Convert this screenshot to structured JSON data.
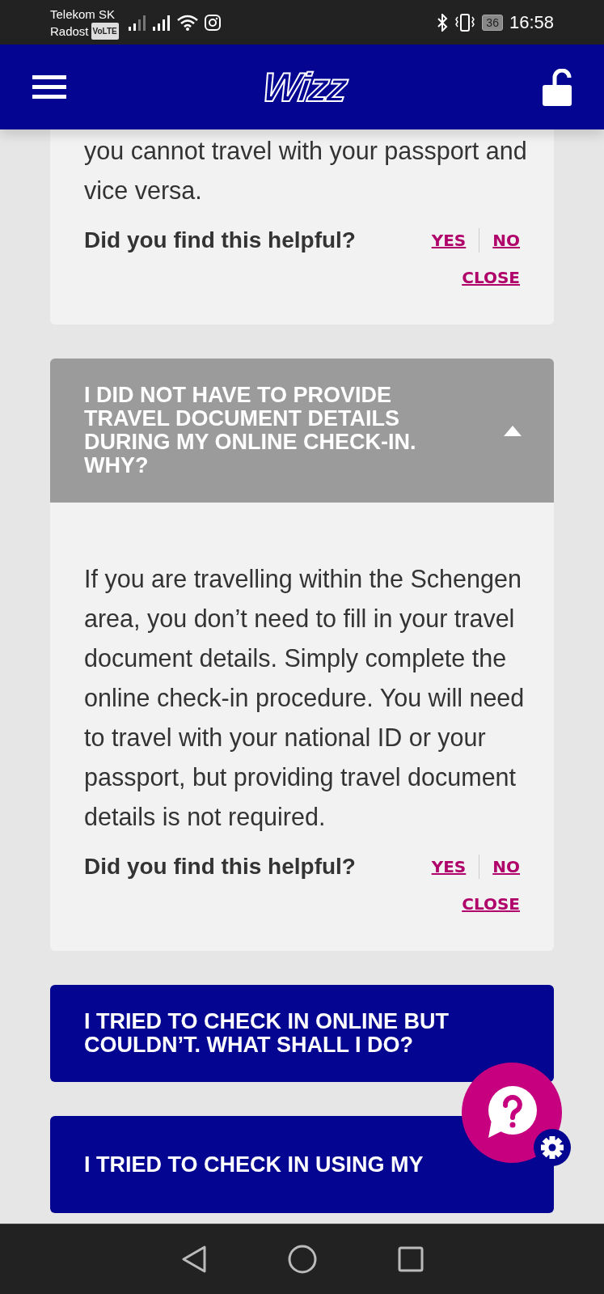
{
  "status_bar": {
    "carrier_line_1": "Telekom SK",
    "carrier_line_2": "Radost",
    "volte_badge": "VoLTE",
    "battery": "36",
    "time": "16:58"
  },
  "header": {
    "logo": "Wizz"
  },
  "faq": [
    {
      "kind": "tail",
      "answer": "you cannot travel with your passport and vice versa.",
      "feedback": {
        "question": "Did you find this helpful?",
        "yes": "YES",
        "no": "NO",
        "close": "CLOSE"
      }
    },
    {
      "kind": "item",
      "question": "I DID NOT HAVE TO PROVIDE TRAVEL DOCUMENT DETAILS DURING MY ONLINE CHECK-IN. WHY?",
      "expanded": true,
      "answer": "If you are travelling within the Schengen area, you don’t need to fill in your travel document details. Simply complete the online check-in procedure. You will need to travel with your national ID or your passport, but providing travel document details is not required.",
      "feedback": {
        "question": "Did you find this helpful?",
        "yes": "YES",
        "no": "NO",
        "close": "CLOSE"
      }
    },
    {
      "kind": "item",
      "question": "I TRIED TO CHECK IN ONLINE BUT COULDN’T. WHAT SHALL I DO?",
      "expanded": false
    },
    {
      "kind": "item",
      "question": "I TRIED TO CHECK IN USING MY",
      "expanded": false
    }
  ]
}
